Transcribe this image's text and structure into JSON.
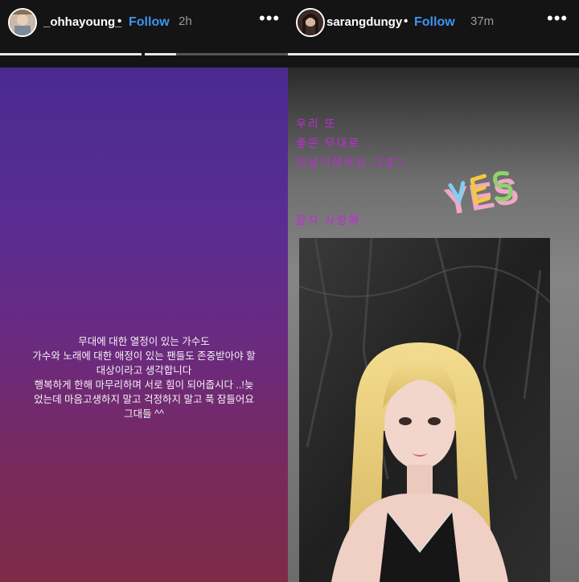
{
  "left_story": {
    "username": "_ohhayoung_",
    "separator": "•",
    "follow_label": "Follow",
    "time": "2h",
    "more_label": "•••",
    "progress": [
      1.0,
      0.22
    ],
    "caption_lines": [
      "무대에 대한 열정이 있는 가수도",
      "가수와 노래에 대한 애정이 있는 팬들도 존중받아야 할",
      "대상이라고 생각합니다",
      "행복하게 한해 마무리하며 서로 힘이 되어줍시다 ..!늦",
      "었는데 마음고생하지 말고 걱정하지 말고 푹 잠들어요",
      "그대들 ^^"
    ]
  },
  "right_story": {
    "username": "sarangdungy",
    "separator": "•",
    "follow_label": "Follow",
    "time": "37m",
    "more_label": "•••",
    "progress": [
      1.0
    ],
    "text_lines": [
      "우리 또",
      "좋은 무대로",
      "만날거잖아요 그쵸?",
      "잘자 사랑해"
    ],
    "sticker_text": "YES",
    "colors": {
      "text_purple": "#c02bd8",
      "follow_blue": "#3d94f0"
    }
  }
}
